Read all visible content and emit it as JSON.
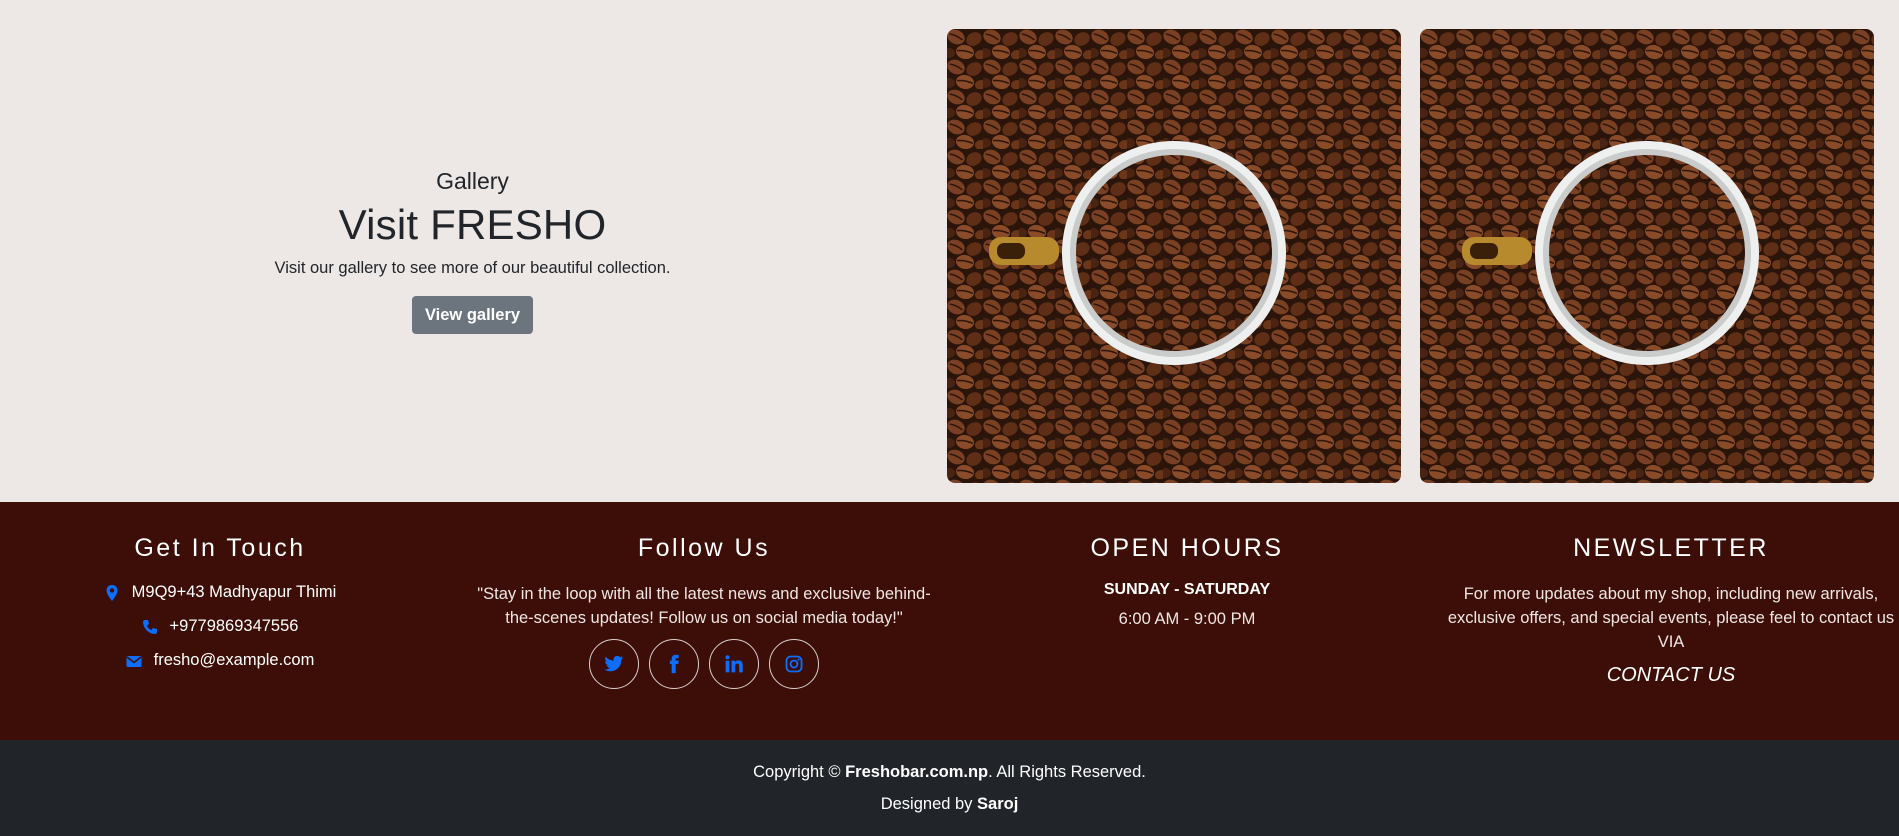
{
  "gallery": {
    "kicker": "Gallery",
    "title": "Visit FRESHO",
    "description": "Visit our gallery to see more of our beautiful collection.",
    "button_label": "View gallery"
  },
  "footer": {
    "get_in_touch": {
      "title": "Get In Touch",
      "address": "M9Q9+43 Madhyapur Thimi",
      "phone": "+9779869347556",
      "email": "fresho@example.com"
    },
    "follow_us": {
      "title": "Follow Us",
      "text": "\"Stay in the loop with all the latest news and exclusive behind-the-scenes updates! Follow us on social media today!\"",
      "socials": [
        "twitter-icon",
        "facebook-icon",
        "linkedin-icon",
        "instagram-icon"
      ]
    },
    "open_hours": {
      "title": "OPEN HOURS",
      "days": "SUNDAY - SATURDAY",
      "hours": "6:00 AM - 9:00 PM"
    },
    "newsletter": {
      "title": "NEWSLETTER",
      "text": "For more updates about my shop, including new arrivals, exclusive offers, and special events, please feel to contact us VIA",
      "link_label": "CONTACT US"
    }
  },
  "bottom": {
    "copyright_prefix": "Copyright © ",
    "site": "Freshobar.com.np",
    "copyright_suffix": ". All Rights Reserved.",
    "designed_prefix": "Designed by ",
    "designer": "Saroj"
  },
  "colors": {
    "accent_blue": "#0d6efd",
    "footer_bg": "#3d0e07",
    "bottom_bg": "#212529",
    "page_bg": "#ede7e6",
    "button_gray": "#6c757d"
  }
}
